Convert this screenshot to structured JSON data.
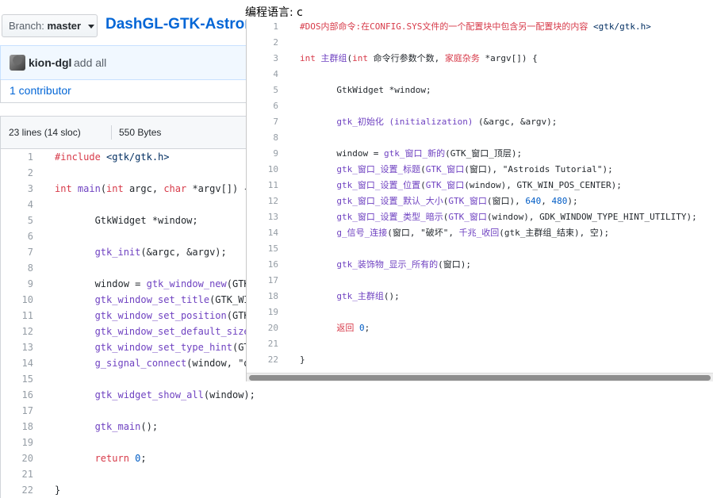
{
  "colors": {
    "link": "#0366d6",
    "keyword": "#d73a49",
    "function": "#6f42c1",
    "string": "#032f62",
    "number": "#005cc5"
  },
  "branch": {
    "label": "Branch:",
    "value": "master",
    "icon": "caret-down-icon"
  },
  "repo": {
    "name": "DashGL-GTK-Astroids-"
  },
  "commit": {
    "author": "kion-dgl",
    "message": "add all"
  },
  "contributors": {
    "text": "1 contributor"
  },
  "file_info": {
    "lines": "23 lines (14 sloc)",
    "size": "550 Bytes"
  },
  "code": [
    {
      "n": "1",
      "tokens": [
        [
          "k",
          "#include "
        ],
        [
          "s",
          "<gtk/gtk.h>"
        ]
      ]
    },
    {
      "n": "2",
      "tokens": []
    },
    {
      "n": "3",
      "tokens": [
        [
          "k",
          "int "
        ],
        [
          "f",
          "main"
        ],
        [
          "",
          "("
        ],
        [
          "k",
          "int"
        ],
        [
          "",
          " argc, "
        ],
        [
          "k",
          "char"
        ],
        [
          "",
          " *argv[]) {"
        ]
      ]
    },
    {
      "n": "4",
      "tokens": []
    },
    {
      "n": "5",
      "tokens": [
        [
          "",
          "       GtkWidget *window;"
        ]
      ]
    },
    {
      "n": "6",
      "tokens": []
    },
    {
      "n": "7",
      "tokens": [
        [
          "",
          "       "
        ],
        [
          "f",
          "gtk_init"
        ],
        [
          "",
          "(&argc, &argv);"
        ]
      ]
    },
    {
      "n": "8",
      "tokens": []
    },
    {
      "n": "9",
      "tokens": [
        [
          "",
          "       window = "
        ],
        [
          "f",
          "gtk_window_new"
        ],
        [
          "",
          "(GTK_WI"
        ]
      ]
    },
    {
      "n": "10",
      "tokens": [
        [
          "",
          "       "
        ],
        [
          "f",
          "gtk_window_set_title"
        ],
        [
          "",
          "(GTK_WINDO"
        ]
      ]
    },
    {
      "n": "11",
      "tokens": [
        [
          "",
          "       "
        ],
        [
          "f",
          "gtk_window_set_position"
        ],
        [
          "",
          "(GTK_WI"
        ]
      ]
    },
    {
      "n": "12",
      "tokens": [
        [
          "",
          "       "
        ],
        [
          "f",
          "gtk_window_set_default_size"
        ],
        [
          "",
          "(GT"
        ]
      ]
    },
    {
      "n": "13",
      "tokens": [
        [
          "",
          "       "
        ],
        [
          "f",
          "gtk_window_set_type_hint"
        ],
        [
          "",
          "(GTK_W"
        ]
      ]
    },
    {
      "n": "14",
      "tokens": [
        [
          "",
          "       "
        ],
        [
          "f",
          "g_signal_connect"
        ],
        [
          "",
          "(window, \"dest"
        ]
      ]
    },
    {
      "n": "15",
      "tokens": []
    },
    {
      "n": "16",
      "tokens": [
        [
          "",
          "       "
        ],
        [
          "f",
          "gtk_widget_show_all"
        ],
        [
          "",
          "(window);"
        ]
      ]
    },
    {
      "n": "17",
      "tokens": []
    },
    {
      "n": "18",
      "tokens": [
        [
          "",
          "       "
        ],
        [
          "f",
          "gtk_main"
        ],
        [
          "",
          "();"
        ]
      ]
    },
    {
      "n": "19",
      "tokens": []
    },
    {
      "n": "20",
      "tokens": [
        [
          "",
          "       "
        ],
        [
          "k",
          "return "
        ],
        [
          "n",
          "0"
        ],
        [
          "",
          ";"
        ]
      ]
    },
    {
      "n": "21",
      "tokens": []
    },
    {
      "n": "22",
      "tokens": [
        [
          "",
          "}"
        ]
      ]
    }
  ],
  "popup": {
    "lang_label": "编程语言: c",
    "lines": [
      {
        "n": "1",
        "tokens": [
          [
            "k",
            "#DOS内部命令:在CONFIG.SYS文件的一个配置块中包含另一配置块的内容 "
          ],
          [
            "s",
            "<gtk/gtk.h>"
          ]
        ]
      },
      {
        "n": "2",
        "tokens": []
      },
      {
        "n": "3",
        "tokens": [
          [
            "k",
            "int "
          ],
          [
            "f",
            "主群组"
          ],
          [
            "",
            "("
          ],
          [
            "k",
            "int"
          ],
          [
            "",
            " 命令行参数个数, "
          ],
          [
            "k",
            "家庭杂务"
          ],
          [
            "",
            " *argv[]) {"
          ]
        ]
      },
      {
        "n": "4",
        "tokens": []
      },
      {
        "n": "5",
        "tokens": [
          [
            "",
            "       GtkWidget *window;"
          ]
        ]
      },
      {
        "n": "6",
        "tokens": []
      },
      {
        "n": "7",
        "tokens": [
          [
            "",
            "       "
          ],
          [
            "f",
            "gtk_初始化 (initialization)"
          ],
          [
            "",
            " (&argc, &argv);"
          ]
        ]
      },
      {
        "n": "8",
        "tokens": []
      },
      {
        "n": "9",
        "tokens": [
          [
            "",
            "       window = "
          ],
          [
            "f",
            "gtk_窗口_新的"
          ],
          [
            "",
            "(GTK_窗口_顶层);"
          ]
        ]
      },
      {
        "n": "10",
        "tokens": [
          [
            "",
            "       "
          ],
          [
            "f",
            "gtk_窗口_设置_标题"
          ],
          [
            "",
            "("
          ],
          [
            "f",
            "GTK_窗口"
          ],
          [
            "",
            "(窗口), \"Astroids Tutorial\");"
          ]
        ]
      },
      {
        "n": "11",
        "tokens": [
          [
            "",
            "       "
          ],
          [
            "f",
            "gtk_窗口_设置_位置"
          ],
          [
            "",
            "("
          ],
          [
            "f",
            "GTK_窗口"
          ],
          [
            "",
            "(window), GTK_WIN_POS_CENTER);"
          ]
        ]
      },
      {
        "n": "12",
        "tokens": [
          [
            "",
            "       "
          ],
          [
            "f",
            "gtk_窗口_设置_默认_大小"
          ],
          [
            "",
            "("
          ],
          [
            "f",
            "GTK_窗口"
          ],
          [
            "",
            "(窗口), "
          ],
          [
            "n",
            "640"
          ],
          [
            "",
            ", "
          ],
          [
            "n",
            "480"
          ],
          [
            "",
            ");"
          ]
        ]
      },
      {
        "n": "13",
        "tokens": [
          [
            "",
            "       "
          ],
          [
            "f",
            "gtk_窗口_设置_类型_暗示"
          ],
          [
            "",
            "("
          ],
          [
            "f",
            "GTK_窗口"
          ],
          [
            "",
            "(window), GDK_WINDOW_TYPE_HINT_UTILITY);"
          ]
        ]
      },
      {
        "n": "14",
        "tokens": [
          [
            "",
            "       "
          ],
          [
            "f",
            "g_信号_连接"
          ],
          [
            "",
            "(窗口, \"破坏\", "
          ],
          [
            "f",
            "千兆_收回"
          ],
          [
            "",
            "(gtk_主群组_结束), 空);"
          ]
        ]
      },
      {
        "n": "15",
        "tokens": []
      },
      {
        "n": "16",
        "tokens": [
          [
            "",
            "       "
          ],
          [
            "f",
            "gtk_装饰物_显示_所有的"
          ],
          [
            "",
            "(窗口);"
          ]
        ]
      },
      {
        "n": "17",
        "tokens": []
      },
      {
        "n": "18",
        "tokens": [
          [
            "",
            "       "
          ],
          [
            "f",
            "gtk_主群组"
          ],
          [
            "",
            "();"
          ]
        ]
      },
      {
        "n": "19",
        "tokens": []
      },
      {
        "n": "20",
        "tokens": [
          [
            "",
            "       "
          ],
          [
            "k",
            "返回 "
          ],
          [
            "n",
            "0"
          ],
          [
            "",
            ";"
          ]
        ]
      },
      {
        "n": "21",
        "tokens": []
      },
      {
        "n": "22",
        "tokens": [
          [
            "",
            "}"
          ]
        ]
      }
    ]
  }
}
